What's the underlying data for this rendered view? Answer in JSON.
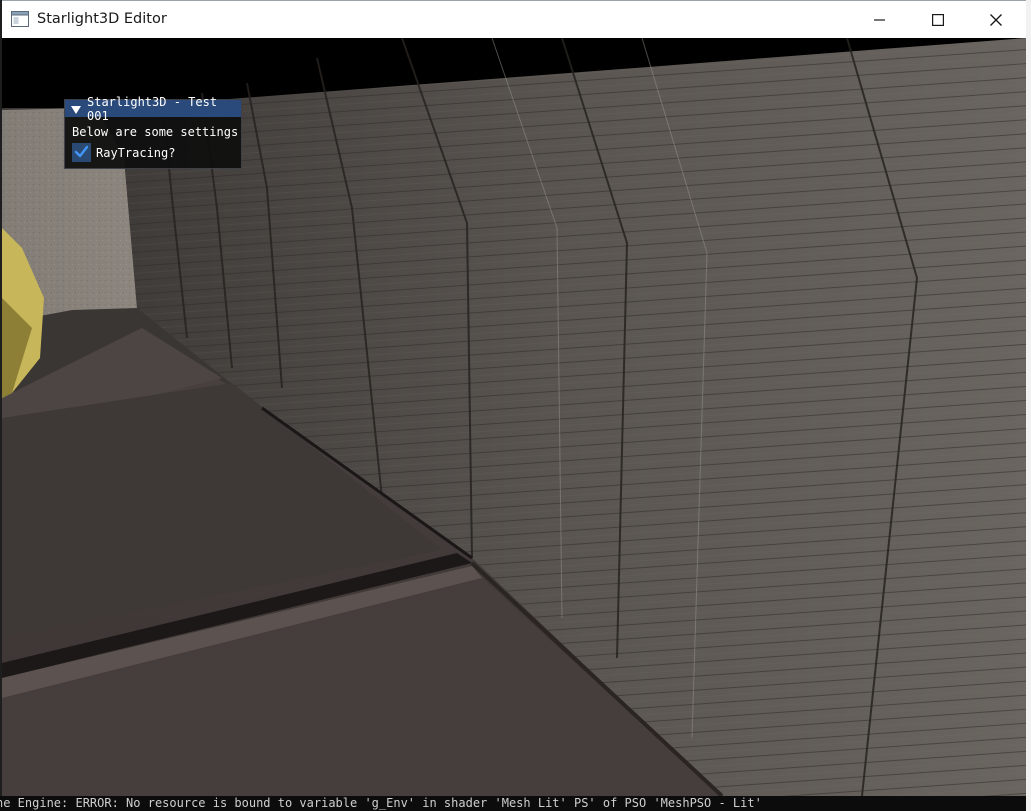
{
  "window": {
    "title": "Starlight3D Editor",
    "icon": "app-window-icon"
  },
  "caption_buttons": {
    "minimize": "minimize-icon",
    "maximize": "maximize-icon",
    "close": "close-icon"
  },
  "imgui_panel": {
    "title": "Starlight3D - Test 001",
    "text": "Below are some settings",
    "checkbox_label": "RayTracing?",
    "checkbox_checked": true,
    "title_color": "#294a7a",
    "checkbox_color": "#2a4a73",
    "check_color": "#4296fa"
  },
  "console": {
    "line": "he Engine: ERROR: No resource is bound to variable 'g_Env' in shader 'Mesh Lit' PS' of PSO 'MeshPSO - Lit'"
  }
}
